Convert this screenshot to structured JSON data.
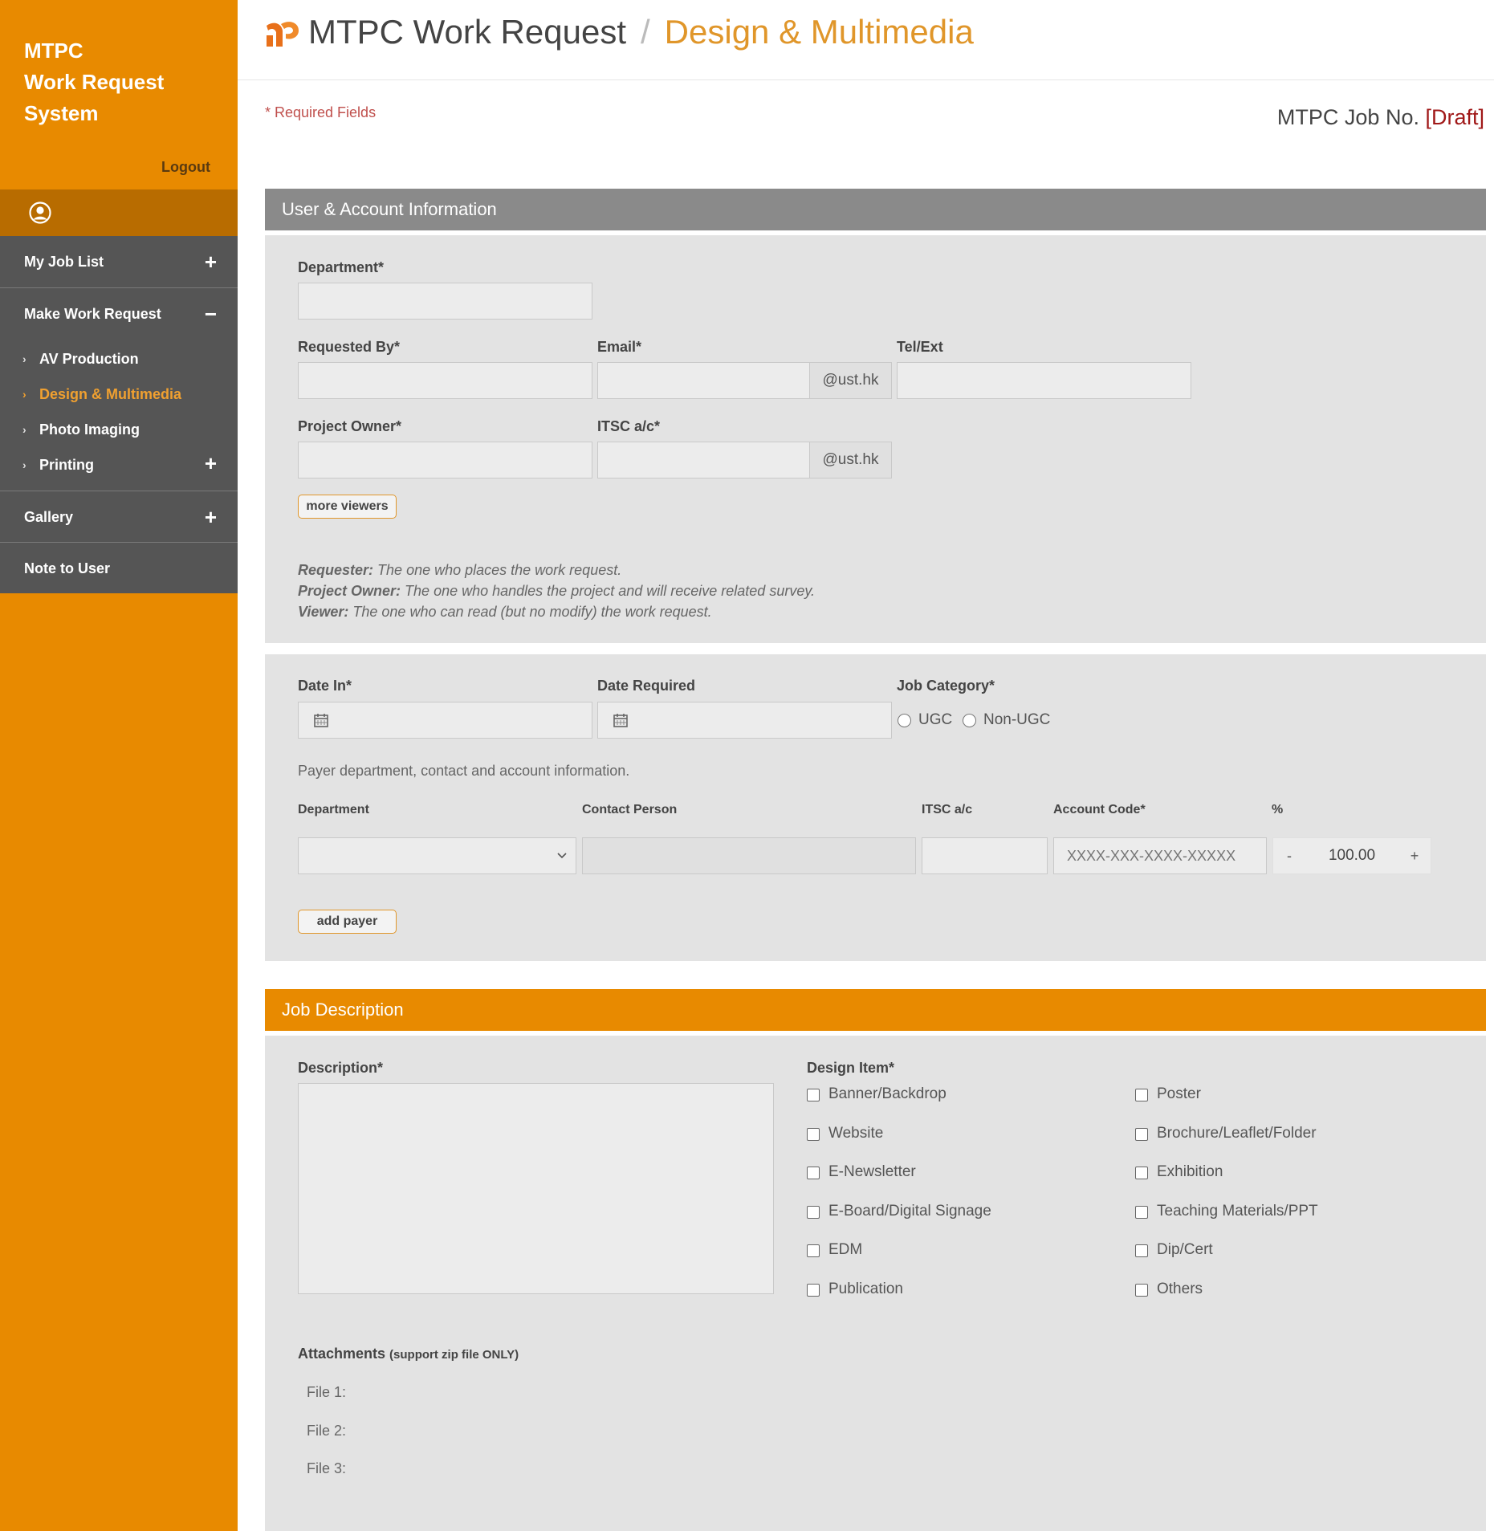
{
  "sidebar": {
    "brand_line1": "MTPC",
    "brand_line2": "Work Request",
    "brand_line3": "System",
    "logout": "Logout",
    "menu": {
      "my_job_list": "My Job List",
      "make_work_request": "Make Work Request",
      "sub_items": [
        "AV Production",
        "Design & Multimedia",
        "Photo Imaging",
        "Printing"
      ],
      "gallery": "Gallery",
      "note_to_user": "Note to User",
      "plus_sign": "+",
      "minus_sign": "−"
    },
    "active_item": "Design & Multimedia"
  },
  "header": {
    "title": "MTPC Work Request",
    "separator": "/",
    "subtitle": "Design & Multimedia",
    "logo_icon": "mtpc-logo-icon"
  },
  "required_fields_note": "* Required Fields",
  "job_no": {
    "label": "MTPC Job No.",
    "value": "[Draft]"
  },
  "user_account": {
    "heading": "User & Account Information",
    "department_label": "Department*",
    "department_value": "",
    "requested_by_label": "Requested By*",
    "requested_by_value": "",
    "email_label": "Email*",
    "email_value": "",
    "email_suffix": "@ust.hk",
    "tel_label": "Tel/Ext",
    "tel_value": "",
    "project_owner_label": "Project Owner*",
    "project_owner_value": "",
    "itsc_label": "ITSC a/c*",
    "itsc_value": "",
    "itsc_suffix": "@ust.hk",
    "more_viewers_button": "more viewers",
    "notes": [
      {
        "term": "Requester:",
        "desc": "The one who places the work request."
      },
      {
        "term": "Project Owner:",
        "desc": "The one who handles the project and will receive related survey."
      },
      {
        "term": "Viewer:",
        "desc": "The one who can read (but no modify) the work request."
      }
    ]
  },
  "dates": {
    "date_in_label": "Date In*",
    "date_in_value": "",
    "date_required_label": "Date Required",
    "date_required_value": "",
    "job_category_label": "Job Category*",
    "category_options": [
      "UGC",
      "Non-UGC"
    ],
    "payer_intro": "Payer department, contact and account information.",
    "payer_columns": [
      "Department",
      "Contact Person",
      "ITSC a/c",
      "Account Code*",
      "%"
    ],
    "payer_row": {
      "department": "",
      "contact_person": "",
      "itsc": "",
      "account_code_placeholder": "XXXX-XXX-XXXX-XXXXX",
      "percent": "100.00",
      "minus": "-",
      "plus": "+"
    },
    "add_payer_button": "add payer"
  },
  "job_description": {
    "heading": "Job Description",
    "description_label": "Description*",
    "description_value": "",
    "design_item_label": "Design Item*",
    "design_items_left": [
      "Banner/Backdrop",
      "Website",
      "E-Newsletter",
      "E-Board/Digital Signage",
      "EDM",
      "Publication"
    ],
    "design_items_right": [
      "Poster",
      "Brochure/Leaflet/Folder",
      "Exhibition",
      "Teaching Materials/PPT",
      "Dip/Cert",
      "Others"
    ],
    "attachments_label": "Attachments",
    "attachments_note": "(support zip file ONLY)",
    "files": [
      "File 1:",
      "File 2:",
      "File 3:"
    ]
  }
}
